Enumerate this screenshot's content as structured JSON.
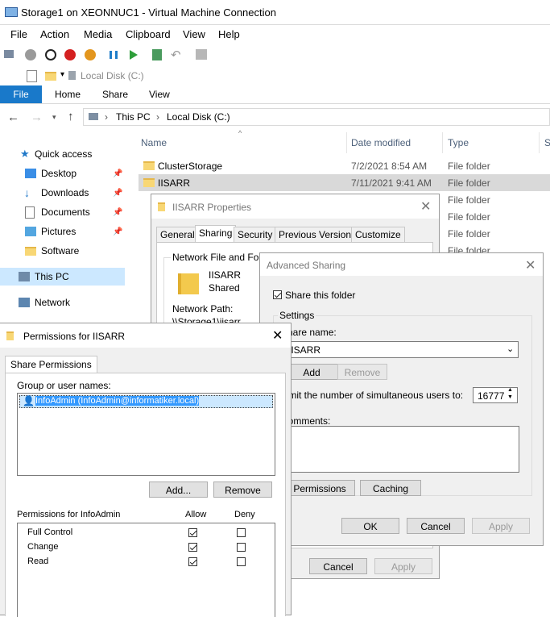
{
  "vm": {
    "title": "Storage1 on XEONNUC1 - Virtual Machine Connection",
    "menu": [
      "File",
      "Action",
      "Media",
      "Clipboard",
      "View",
      "Help"
    ]
  },
  "explorer": {
    "qat_title": "Local Disk (C:)",
    "ribbon_tabs": [
      "File",
      "Home",
      "Share",
      "View"
    ],
    "breadcrumb": [
      "This PC",
      "Local Disk (C:)"
    ],
    "nav": {
      "quick_access": "Quick access",
      "pinned": [
        "Desktop",
        "Downloads",
        "Documents",
        "Pictures"
      ],
      "software": "Software",
      "this_pc": "This PC",
      "network": "Network"
    },
    "columns": {
      "name": "Name",
      "date": "Date modified",
      "type": "Type",
      "size": "S"
    },
    "rows": [
      {
        "name": "ClusterStorage",
        "date": "7/2/2021 8:54 AM",
        "type": "File folder"
      },
      {
        "name": "IISARR",
        "date": "7/11/2021 9:41 AM",
        "type": "File folder"
      },
      {
        "type": "File folder"
      },
      {
        "type": "File folder"
      },
      {
        "type": "File folder"
      },
      {
        "type": "File folder"
      }
    ]
  },
  "properties": {
    "title": "IISARR Properties",
    "tabs": [
      "General",
      "Sharing",
      "Security",
      "Previous Versions",
      "Customize"
    ],
    "section": "Network File and Folder",
    "folder_name": "IISARR",
    "folder_state": "Shared",
    "network_path_label": "Network Path:",
    "network_path": "\\\\Storage1\\iisarr",
    "cancel": "Cancel",
    "apply": "Apply"
  },
  "advanced": {
    "title": "Advanced Sharing",
    "share_this_folder": "Share this folder",
    "settings": "Settings",
    "share_name_label": "Share name:",
    "share_name_value": "IISARR",
    "add": "Add",
    "remove": "Remove",
    "limit_label": "Limit the number of simultaneous users to:",
    "limit_value": "16777",
    "comments_label": "Comments:",
    "permissions": "Permissions",
    "caching": "Caching",
    "ok": "OK",
    "cancel": "Cancel",
    "apply": "Apply"
  },
  "permissions": {
    "title": "Permissions for IISARR",
    "tab": "Share Permissions",
    "group_label": "Group or user names:",
    "users": [
      "InfoAdmin (InfoAdmin@informatiker.local)"
    ],
    "add": "Add...",
    "remove": "Remove",
    "perm_label": "Permissions for InfoAdmin",
    "allow": "Allow",
    "deny": "Deny",
    "perms": [
      {
        "name": "Full Control",
        "allow": true,
        "deny": false
      },
      {
        "name": "Change",
        "allow": true,
        "deny": false
      },
      {
        "name": "Read",
        "allow": true,
        "deny": false
      }
    ]
  }
}
